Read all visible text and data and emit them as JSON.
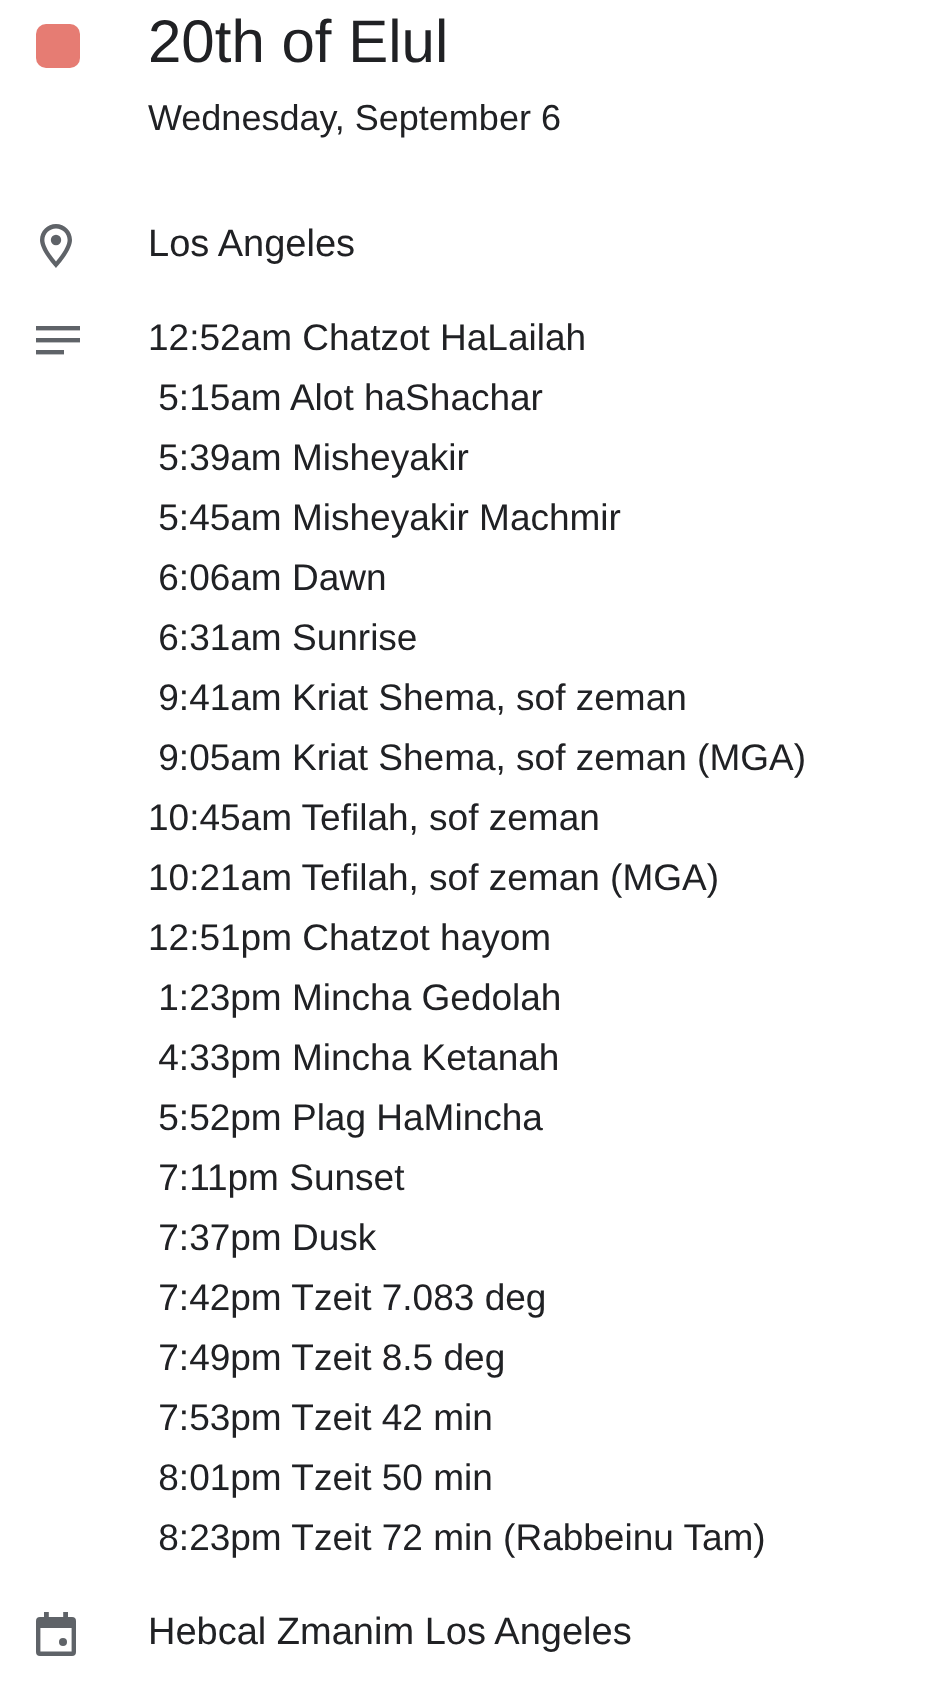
{
  "event": {
    "title": "20th of Elul",
    "color": "#e67c73",
    "date": "Wednesday, September 6"
  },
  "location": "Los Angeles",
  "zmanim": [
    "12:52am Chatzot HaLailah",
    " 5:15am Alot haShachar",
    " 5:39am Misheyakir",
    " 5:45am Misheyakir Machmir",
    " 6:06am Dawn",
    " 6:31am Sunrise",
    " 9:41am Kriat Shema, sof zeman",
    " 9:05am Kriat Shema, sof zeman (MGA)",
    "10:45am Tefilah, sof zeman",
    "10:21am Tefilah, sof zeman (MGA)",
    "12:51pm Chatzot hayom",
    " 1:23pm Mincha Gedolah",
    " 4:33pm Mincha Ketanah",
    " 5:52pm Plag HaMincha",
    " 7:11pm Sunset",
    " 7:37pm Dusk",
    " 7:42pm Tzeit 7.083 deg",
    " 7:49pm Tzeit 8.5 deg",
    " 7:53pm Tzeit 42 min",
    " 8:01pm Tzeit 50 min",
    " 8:23pm Tzeit 72 min (Rabbeinu Tam)"
  ],
  "calendar": "Hebcal Zmanim Los Angeles"
}
